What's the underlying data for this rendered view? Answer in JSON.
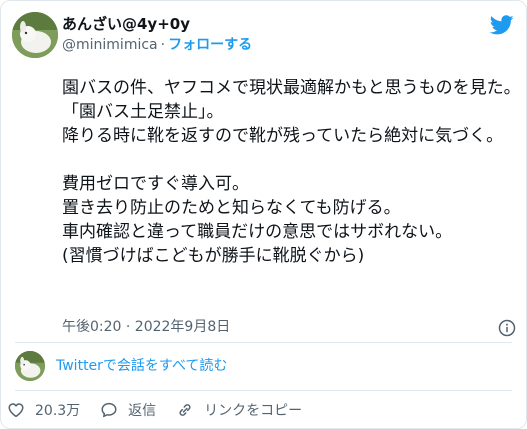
{
  "author": {
    "display_name": "あんざい@4y+0y",
    "handle": "@minimimica",
    "separator": "·",
    "follow_label": "フォローする"
  },
  "tweet": {
    "text": "園バスの件、ヤフコメで現状最適解かもと思うものを見た。\n「園バス土足禁止」。\n降りる時に靴を返すので靴が残っていたら絶対に気づく。\n\n費用ゼロですぐ導入可。\n置き去り防止のためと知らなくても防げる。\n車内確認と違って職員だけの意思ではサボれない。\n(習慣づけばこどもが勝手に靴脱ぐから)",
    "timestamp": "午後0:20 · 2022年9月8日"
  },
  "conversation": {
    "link_label": "Twitterで会話をすべて読む"
  },
  "actions": {
    "like_count": "20.3万",
    "reply_label": "返信",
    "copy_link_label": "リンクをコピー"
  },
  "icons": {
    "brand": "twitter-bird-icon",
    "info": "info-icon",
    "like": "heart-icon",
    "reply": "speech-bubble-icon",
    "copy_link": "link-icon"
  },
  "colors": {
    "accent": "#1d9bf0",
    "text": "#0f1419",
    "muted": "#536471",
    "border": "#e1e8ed"
  }
}
